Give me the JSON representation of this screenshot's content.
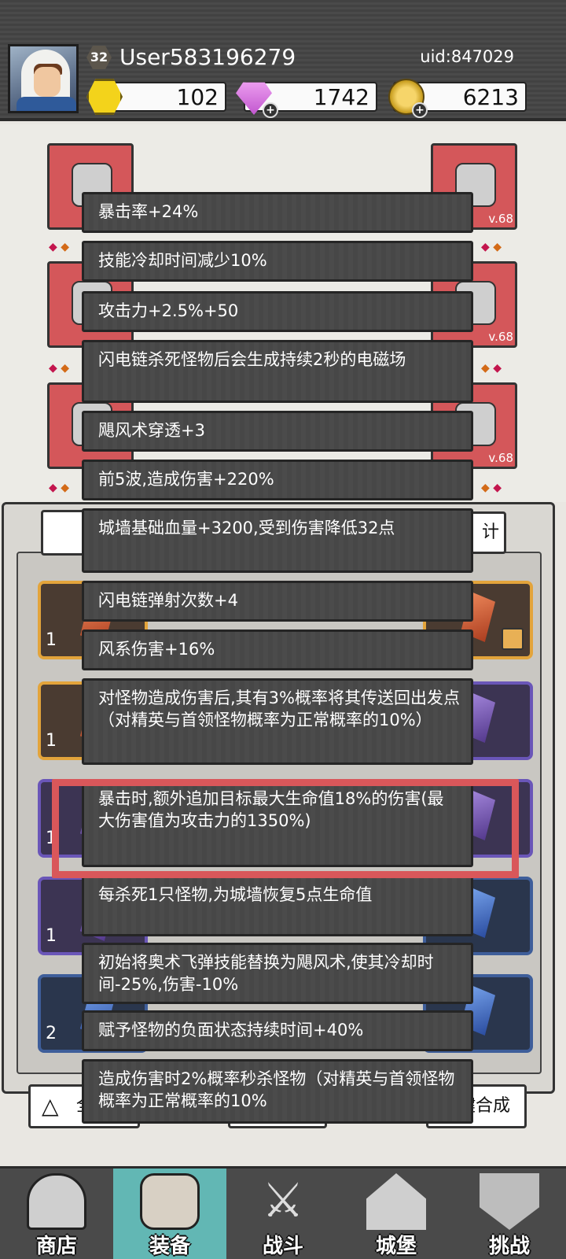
{
  "header": {
    "level": "32",
    "username": "User583196279",
    "uid": "uid:847029",
    "currencies": [
      {
        "icon": "gold-gem-icon",
        "value": "102"
      },
      {
        "icon": "diamond-icon",
        "value": "1742"
      },
      {
        "icon": "coin-icon",
        "value": "6213"
      }
    ]
  },
  "equipment": {
    "slots": [
      {
        "name": "helmet-slot",
        "level": "v.68"
      },
      {
        "name": "armor-slot",
        "level": "v.68"
      },
      {
        "name": "boots-slot",
        "level": "v.68"
      },
      {
        "name": "weapon-slot",
        "level": "v.68"
      }
    ]
  },
  "bag": {
    "stats_button": "计",
    "left_button": "全",
    "right_button": "键合成",
    "counts": [
      "1",
      "1",
      "1",
      "1",
      "2"
    ]
  },
  "tooltips": [
    "暴击率+24%",
    "技能冷却时间减少10%",
    "攻击力+2.5%+50",
    "闪电链杀死怪物后会生成持续2秒的电磁场",
    "飓风术穿透+3",
    "前5波,造成伤害+220%",
    "城墙基础血量+3200,受到伤害降低32点",
    "闪电链弹射次数+4",
    "风系伤害+16%",
    "对怪物造成伤害后,其有3%概率将其传送回出发点（对精英与首领怪物概率为正常概率的10%）",
    "暴击时,额外追加目标最大生命值18%的伤害(最大伤害值为攻击力的1350%)",
    "每杀死1只怪物,为城墙恢复5点生命值",
    "初始将奥术飞弹技能替换为飓风术,使其冷却时间-25%,伤害-10%",
    "赋予怪物的负面状态持续时间+40%",
    "造成伤害时2%概率秒杀怪物（对精英与首领怪物概率为正常概率的10%"
  ],
  "nav": [
    {
      "label": "商店",
      "icon": "shop-icon"
    },
    {
      "label": "装备",
      "icon": "backpack-icon"
    },
    {
      "label": "战斗",
      "icon": "crossed-swords-icon"
    },
    {
      "label": "城堡",
      "icon": "castle-icon"
    },
    {
      "label": "挑战",
      "icon": "shield-icon"
    }
  ],
  "colors": {
    "highlight": "#d9575a",
    "active_tab": "#62b7b4",
    "slot_red": "#d4575a"
  }
}
